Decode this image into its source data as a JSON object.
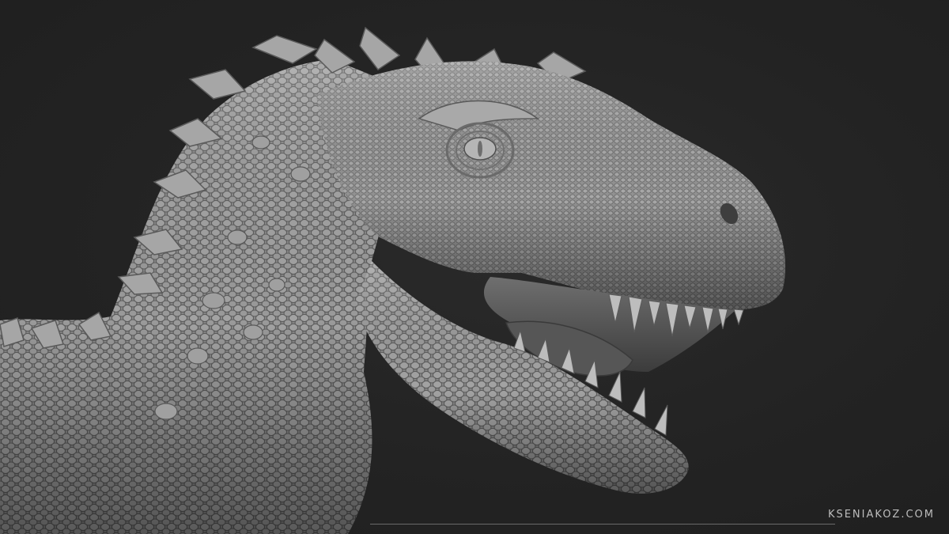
{
  "scene": {
    "subject": "dinosaur-sculpt",
    "background_color": "#232323",
    "sculpt_color": "#8c8c8c"
  },
  "watermark": {
    "text": "KSENIAKOZ.COM"
  }
}
